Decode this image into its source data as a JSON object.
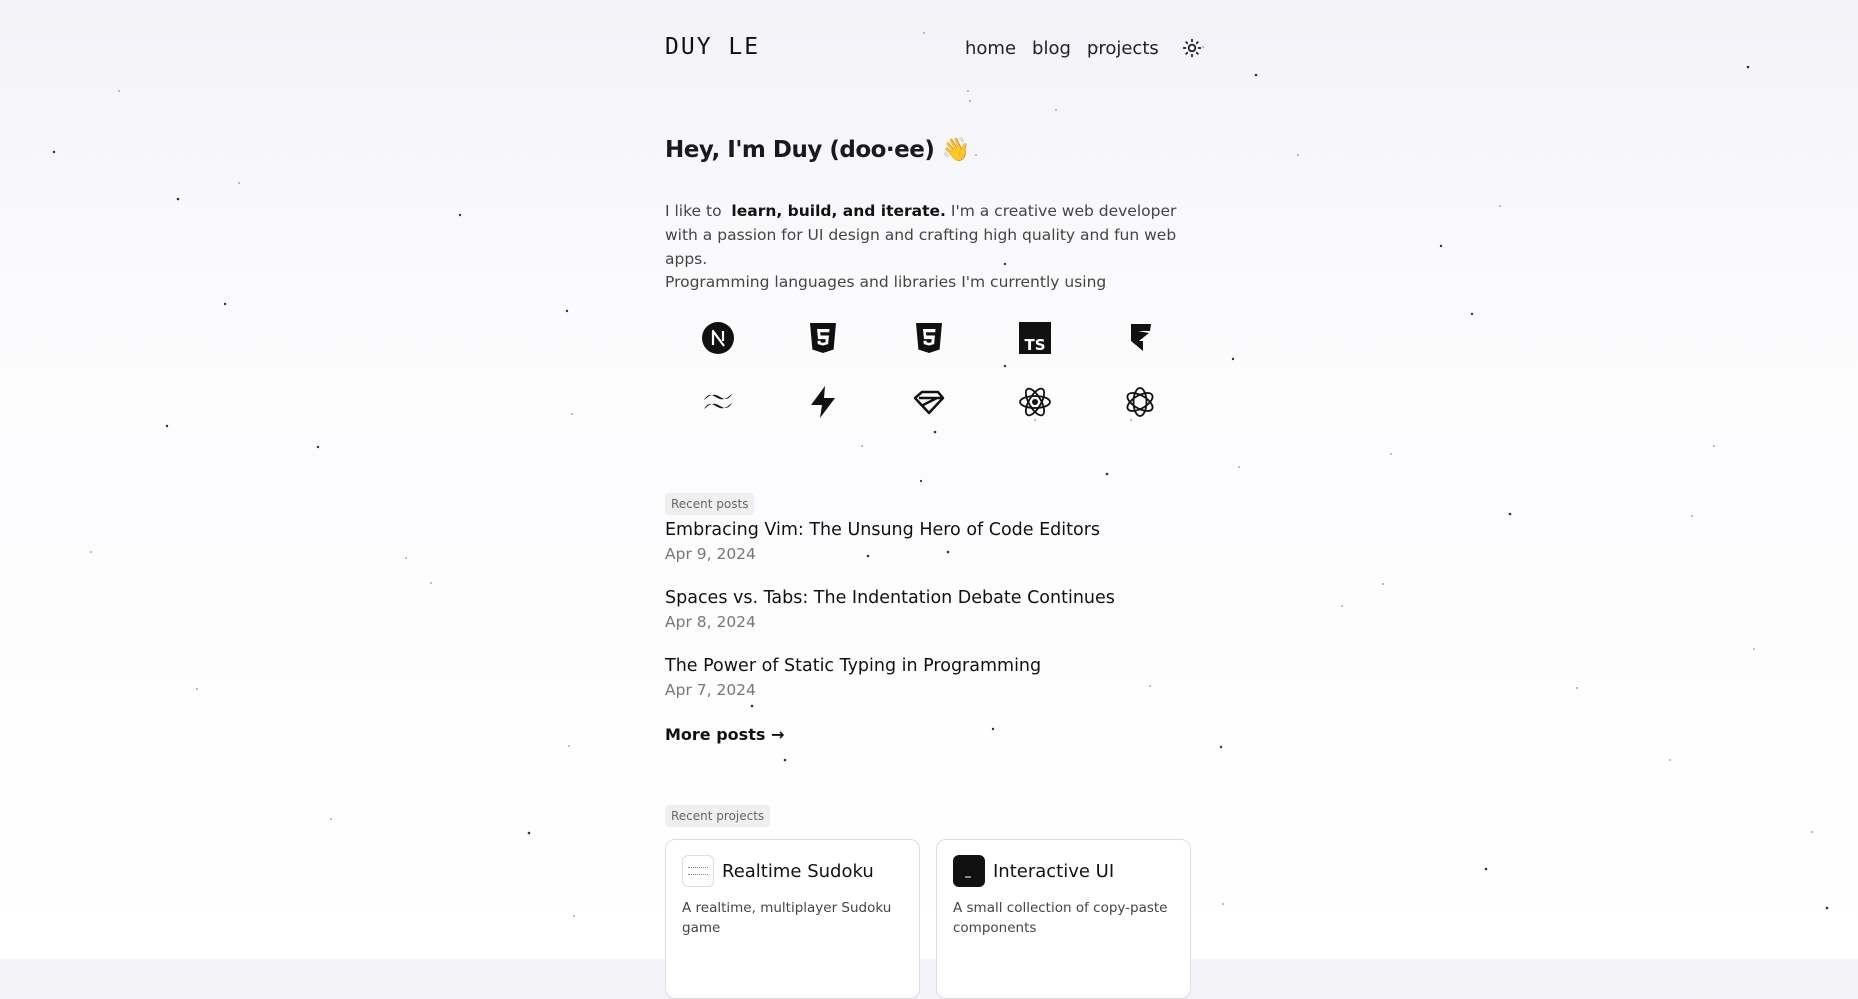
{
  "site": {
    "logo": "DUY LE"
  },
  "nav": {
    "items": [
      {
        "label": "home"
      },
      {
        "label": "blog"
      },
      {
        "label": "projects"
      }
    ],
    "theme_icon": "sun-icon"
  },
  "hero": {
    "greeting": "Hey, I'm Duy (doo·ee)",
    "greeting_emoji": "👋",
    "intro_lead": "I like to",
    "intro_bold": "learn, build, and iterate.",
    "intro_rest": "I'm a creative web developer with a passion for UI design and crafting high quality and fun web apps.",
    "tech_label": "Programming languages and libraries I'm currently using"
  },
  "tech_icons": [
    "nextjs-icon",
    "html5-icon",
    "css3-icon",
    "typescript-icon",
    "framer-icon",
    "tailwind-icon",
    "supabase-icon",
    "svelte-icon",
    "react-icon",
    "reactquery-icon"
  ],
  "recent_posts": {
    "label": "Recent posts",
    "posts": [
      {
        "title": "Embracing Vim: The Unsung Hero of Code Editors",
        "date": "Apr 9, 2024"
      },
      {
        "title": "Spaces vs. Tabs: The Indentation Debate Continues",
        "date": "Apr 8, 2024"
      },
      {
        "title": "The Power of Static Typing in Programming",
        "date": "Apr 7, 2024"
      }
    ],
    "more_label": "More posts →"
  },
  "recent_projects": {
    "label": "Recent projects",
    "projects": [
      {
        "title": "Realtime Sudoku",
        "description": "A realtime, multiplayer Sudoku game"
      },
      {
        "title": "Interactive UI",
        "description": "A small collection of copy-paste components"
      }
    ]
  }
}
